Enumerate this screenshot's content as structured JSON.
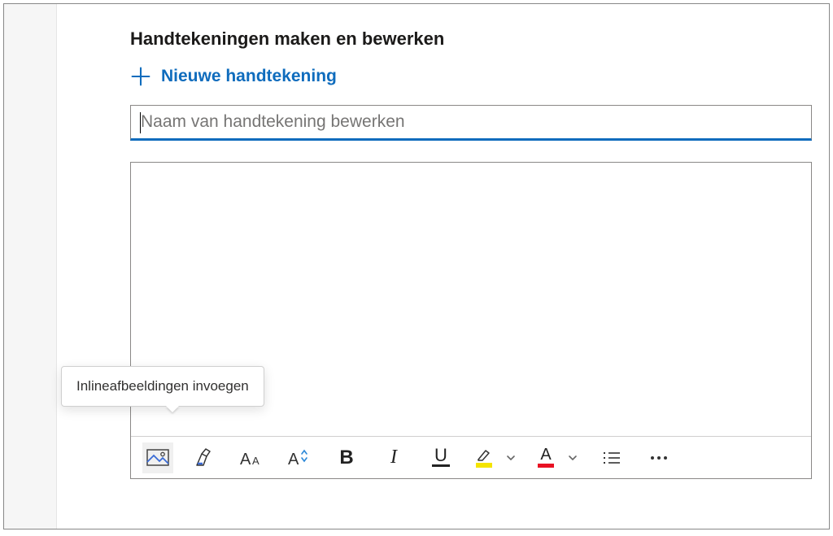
{
  "section_title": "Handtekeningen maken en bewerken",
  "new_signature_label": "Nieuwe handtekening",
  "name_input": {
    "placeholder": "Naam van handtekening bewerken",
    "value": ""
  },
  "tooltip_text": "Inlineafbeeldingen invoegen",
  "toolbar": {
    "insert_image": "insert-image",
    "format_painter": "format-painter",
    "font": "font",
    "font_size": "font-size",
    "bold": "B",
    "italic": "I",
    "underline": "U",
    "highlight": "highlight",
    "font_color": "A",
    "bullets": "bullets",
    "more": "more"
  },
  "colors": {
    "accent": "#0f6cbd",
    "highlight": "#f4e400",
    "fontcolor": "#e81123"
  }
}
